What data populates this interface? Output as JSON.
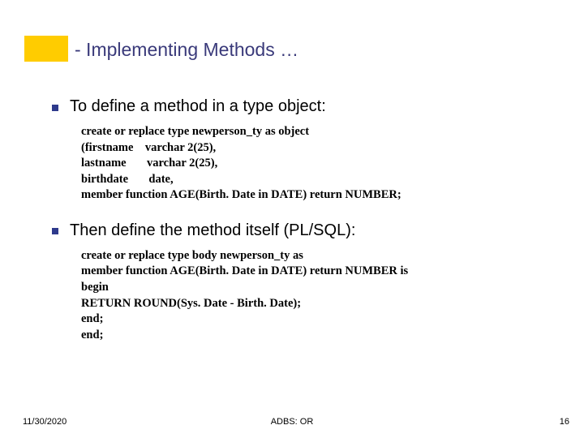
{
  "accent_color": "#ffcc00",
  "title_color": "#3a3a7a",
  "bullet_color": "#2e3a8c",
  "title": "- Implementing Methods …",
  "sections": [
    {
      "heading": "To define a method in a type object:",
      "code": "create or replace type newperson_ty as object\n(firstname    varchar 2(25),\nlastname       varchar 2(25),\nbirthdate       date,\nmember function AGE(Birth. Date in DATE) return NUMBER;"
    },
    {
      "heading": "Then define the method itself (PL/SQL):",
      "code": "create or replace type body newperson_ty as\nmember function AGE(Birth. Date in DATE) return NUMBER is\nbegin\nRETURN ROUND(Sys. Date - Birth. Date);\nend;\nend;"
    }
  ],
  "footer": {
    "date": "11/30/2020",
    "center": "ADBS: OR",
    "page": "16"
  }
}
